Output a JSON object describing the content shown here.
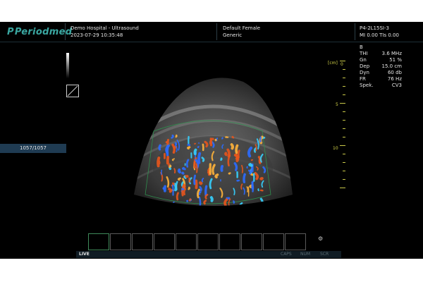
{
  "header": {
    "brand": "Periodmed",
    "brand_mark": "P",
    "hospital": "Demo Hospital - Ultrasound",
    "datetime": "2023-07-29 10:35:48",
    "patient_name": "Default Female",
    "patient_type": "Generic",
    "probe": "P4-2L15SI-3",
    "indices": "MI 0.00 TIs 0.00"
  },
  "params": {
    "mode": "B",
    "rows": [
      {
        "key": "THI",
        "value": "3.6 MHz"
      },
      {
        "key": "Gn",
        "value": "51 %"
      },
      {
        "key": "Dep",
        "value": "15.0 cm"
      },
      {
        "key": "Dyn",
        "value": "60 db"
      },
      {
        "key": "FR",
        "value": "76 Hz"
      },
      {
        "key": "Spek.",
        "value": "CV3"
      }
    ]
  },
  "frame_counter": "1057/1057",
  "ruler": {
    "unit": "[cm]",
    "labels": [
      "0",
      "5",
      "10"
    ]
  },
  "status": {
    "live": "LIVE",
    "caps": "CAPS",
    "num": "NUM",
    "scr": "SCR"
  },
  "colors": {
    "brand": "#3aa6a0",
    "ruler": "#d6d64a",
    "roi": "#2f8f4e",
    "doppler_red": "#e8551c",
    "doppler_blue": "#2b6bff",
    "doppler_orange": "#ffb23a",
    "doppler_cyan": "#35d0ff"
  },
  "icons": {
    "grayscale_bar": "grayscale-bar-icon",
    "roi": "roi-box-icon",
    "corner": "probe-orientation-icon"
  }
}
